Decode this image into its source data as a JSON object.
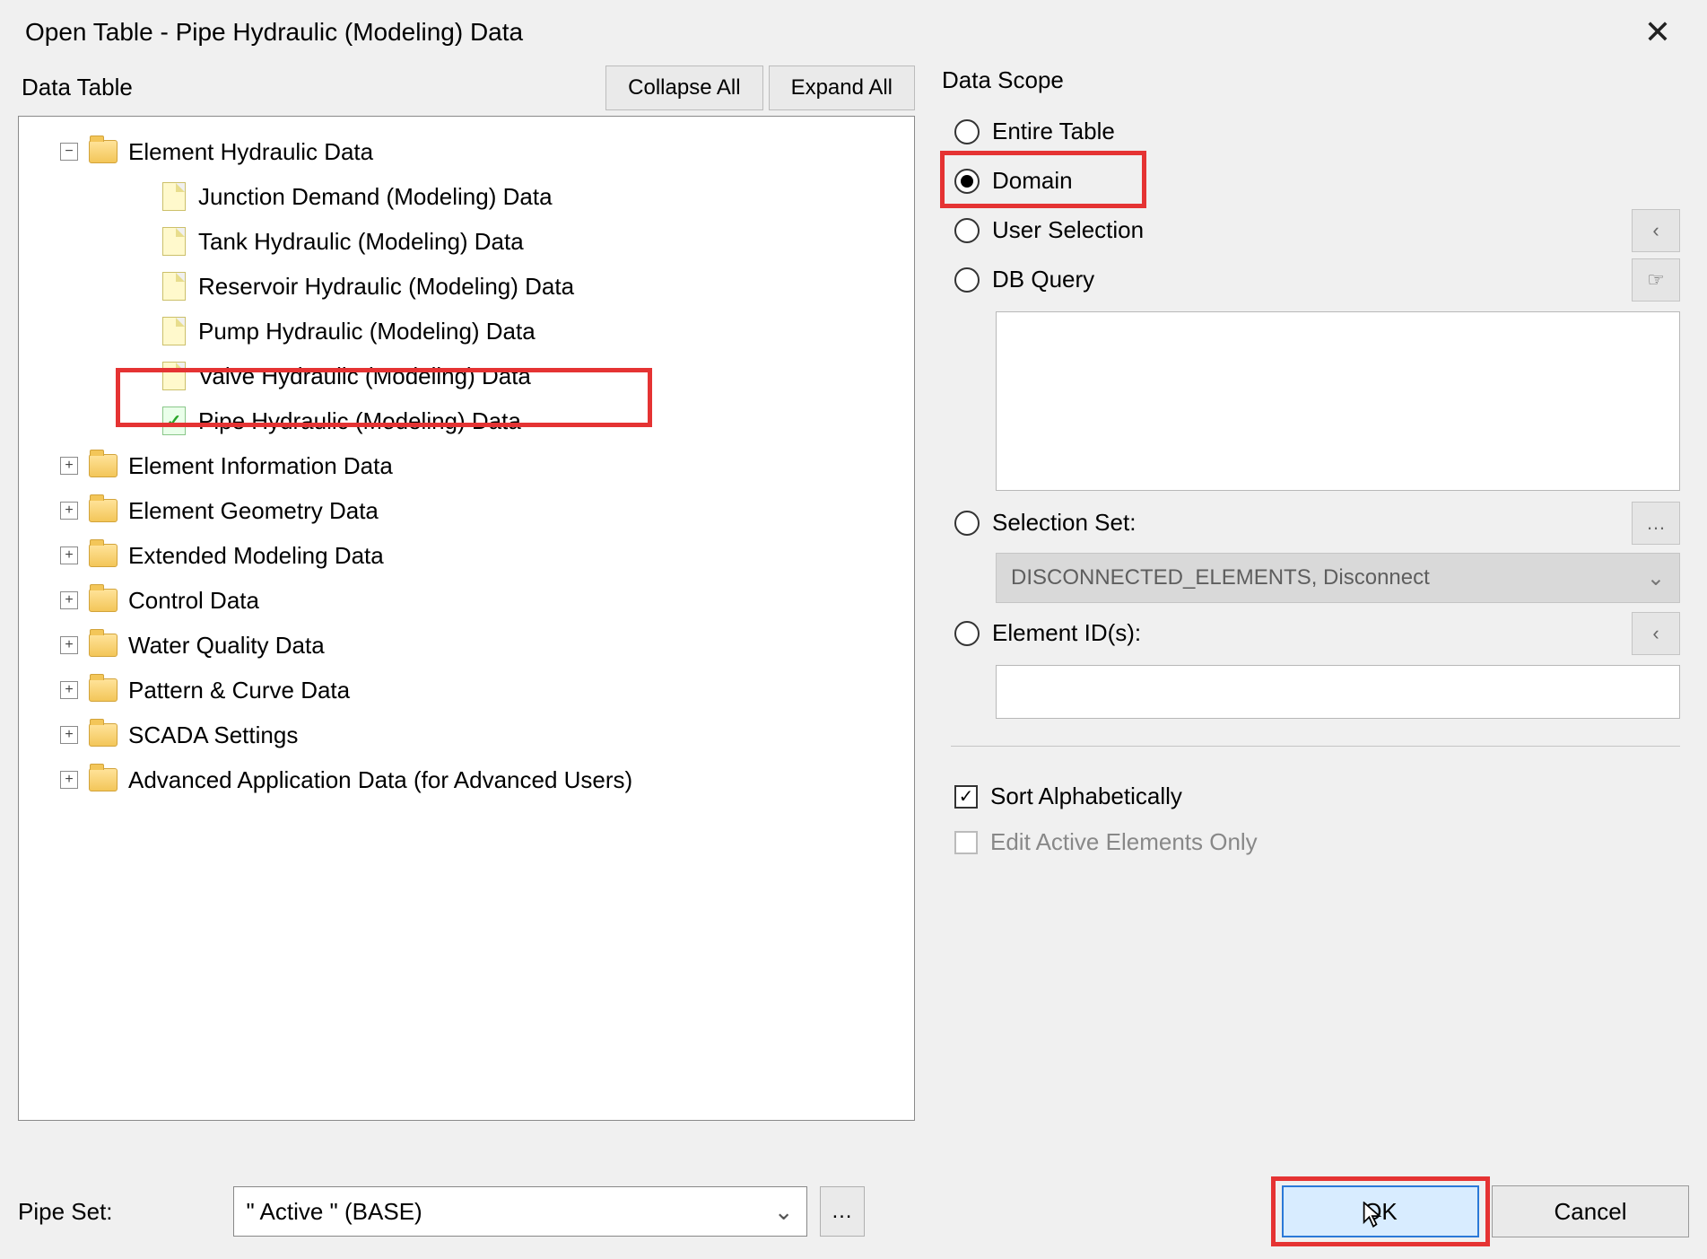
{
  "title": "Open Table - Pipe Hydraulic (Modeling) Data",
  "left": {
    "heading": "Data Table",
    "collapse": "Collapse All",
    "expand": "Expand All"
  },
  "tree": {
    "root0": "Element Hydraulic Data",
    "c0": "Junction Demand (Modeling) Data",
    "c1": "Tank Hydraulic (Modeling) Data",
    "c2": "Reservoir Hydraulic (Modeling) Data",
    "c3": "Pump Hydraulic (Modeling) Data",
    "c4": "Valve Hydraulic (Modeling) Data",
    "c5": "Pipe Hydraulic (Modeling) Data",
    "root1": "Element Information Data",
    "root2": "Element Geometry Data",
    "root3": "Extended Modeling Data",
    "root4": "Control Data",
    "root5": "Water Quality Data",
    "root6": "Pattern & Curve Data",
    "root7": "SCADA Settings",
    "root8": "Advanced Application Data (for Advanced Users)"
  },
  "scope": {
    "title": "Data Scope",
    "entire": "Entire Table",
    "domain": "Domain",
    "user": "User Selection",
    "dbq": "DB Query",
    "selset": "Selection Set:",
    "selset_value": "DISCONNECTED_ELEMENTS, Disconnect",
    "elemids": "Element ID(s):",
    "sort": "Sort Alphabetically",
    "editactive": "Edit Active Elements Only"
  },
  "footer": {
    "pipeset_label": "Pipe Set:",
    "pipeset_value": "\" Active \" (BASE)",
    "ok": "OK",
    "cancel": "Cancel"
  }
}
